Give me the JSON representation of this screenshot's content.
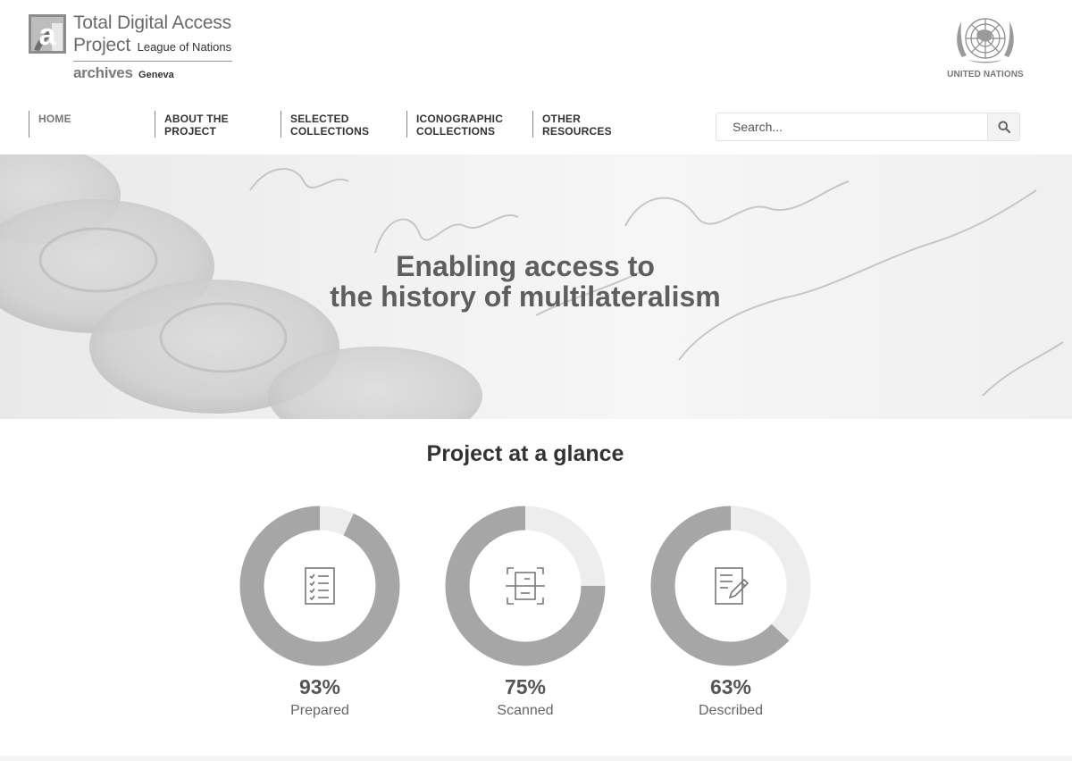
{
  "header": {
    "logo": {
      "line1": "Total Digital Access",
      "line2_main": "Project",
      "line2_small": "League of Nations",
      "line3_main": "archives",
      "line3_small": "Geneva"
    },
    "un_label": "UNITED NATIONS"
  },
  "nav": {
    "items": [
      {
        "line1": "HOME",
        "line2": ""
      },
      {
        "line1": "ABOUT THE",
        "line2": "PROJECT"
      },
      {
        "line1": "SELECTED",
        "line2": "COLLECTIONS"
      },
      {
        "line1": "ICONOGRAPHIC",
        "line2": "COLLECTIONS"
      },
      {
        "line1": "OTHER",
        "line2": "RESOURCES"
      }
    ]
  },
  "search": {
    "placeholder": "Search...",
    "icon": "search-icon"
  },
  "hero": {
    "line1": "Enabling access to",
    "line2": "the history of multilateralism"
  },
  "glance": {
    "title": "Project at a glance",
    "stats": [
      {
        "value_text": "93%",
        "value": 0.93,
        "label": "Prepared",
        "icon": "checklist-icon"
      },
      {
        "value_text": "75%",
        "value": 0.75,
        "label": "Scanned",
        "icon": "scan-icon"
      },
      {
        "value_text": "63%",
        "value": 0.63,
        "label": "Described",
        "icon": "document-edit-icon"
      }
    ]
  },
  "colors": {
    "ring_fill": "#a6a6a6",
    "ring_track": "#ededed",
    "icon": "#777777"
  }
}
